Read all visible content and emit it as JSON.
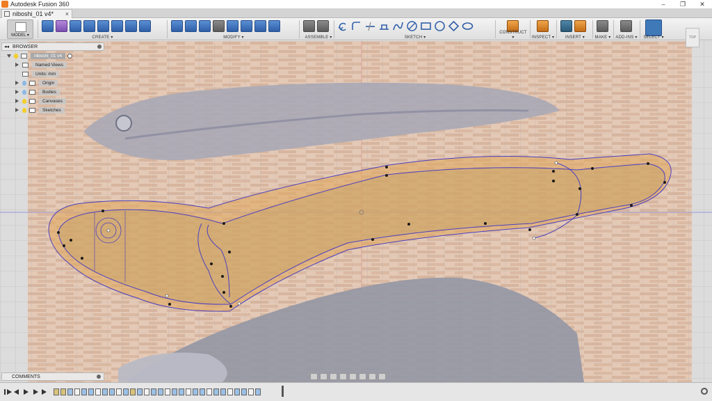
{
  "app": {
    "title": "Autodesk Fusion 360",
    "window_buttons": [
      "–",
      "❐",
      "✕"
    ]
  },
  "document": {
    "tab_title": "niboshi_01 v4*",
    "tab_close": "×"
  },
  "toolbar": {
    "model_label": "MODEL ▾",
    "groups": [
      {
        "label": "CREATE ▾"
      },
      {
        "label": "MODIFY ▾"
      },
      {
        "label": "ASSEMBLE ▾"
      },
      {
        "label": "SKETCH ▾"
      },
      {
        "label": "CONSTRUCT ▾"
      },
      {
        "label": "INSPECT ▾"
      },
      {
        "label": "INSERT ▾"
      },
      {
        "label": "MAKE ▾"
      },
      {
        "label": "ADD-INS ▾"
      },
      {
        "label": "SELECT ▾"
      }
    ]
  },
  "browser": {
    "title": "BROWSER",
    "collapse": "◂◂",
    "root": "niboshi_01 v4",
    "items": [
      {
        "label": "Named Views",
        "type": "folder"
      },
      {
        "label": "Units: mm",
        "type": "units"
      },
      {
        "label": "Origin",
        "type": "folder"
      },
      {
        "label": "Bodies",
        "type": "folder"
      },
      {
        "label": "Canvases",
        "type": "folder"
      },
      {
        "label": "Sketches",
        "type": "folder"
      }
    ]
  },
  "viewcube": {
    "face": "TOP"
  },
  "comments": {
    "title": "COMMENTS"
  },
  "colors": {
    "sketch_line": "#4a3fc0",
    "profile_fill": "#e0a55a",
    "select_blue": "#3f79b8"
  }
}
